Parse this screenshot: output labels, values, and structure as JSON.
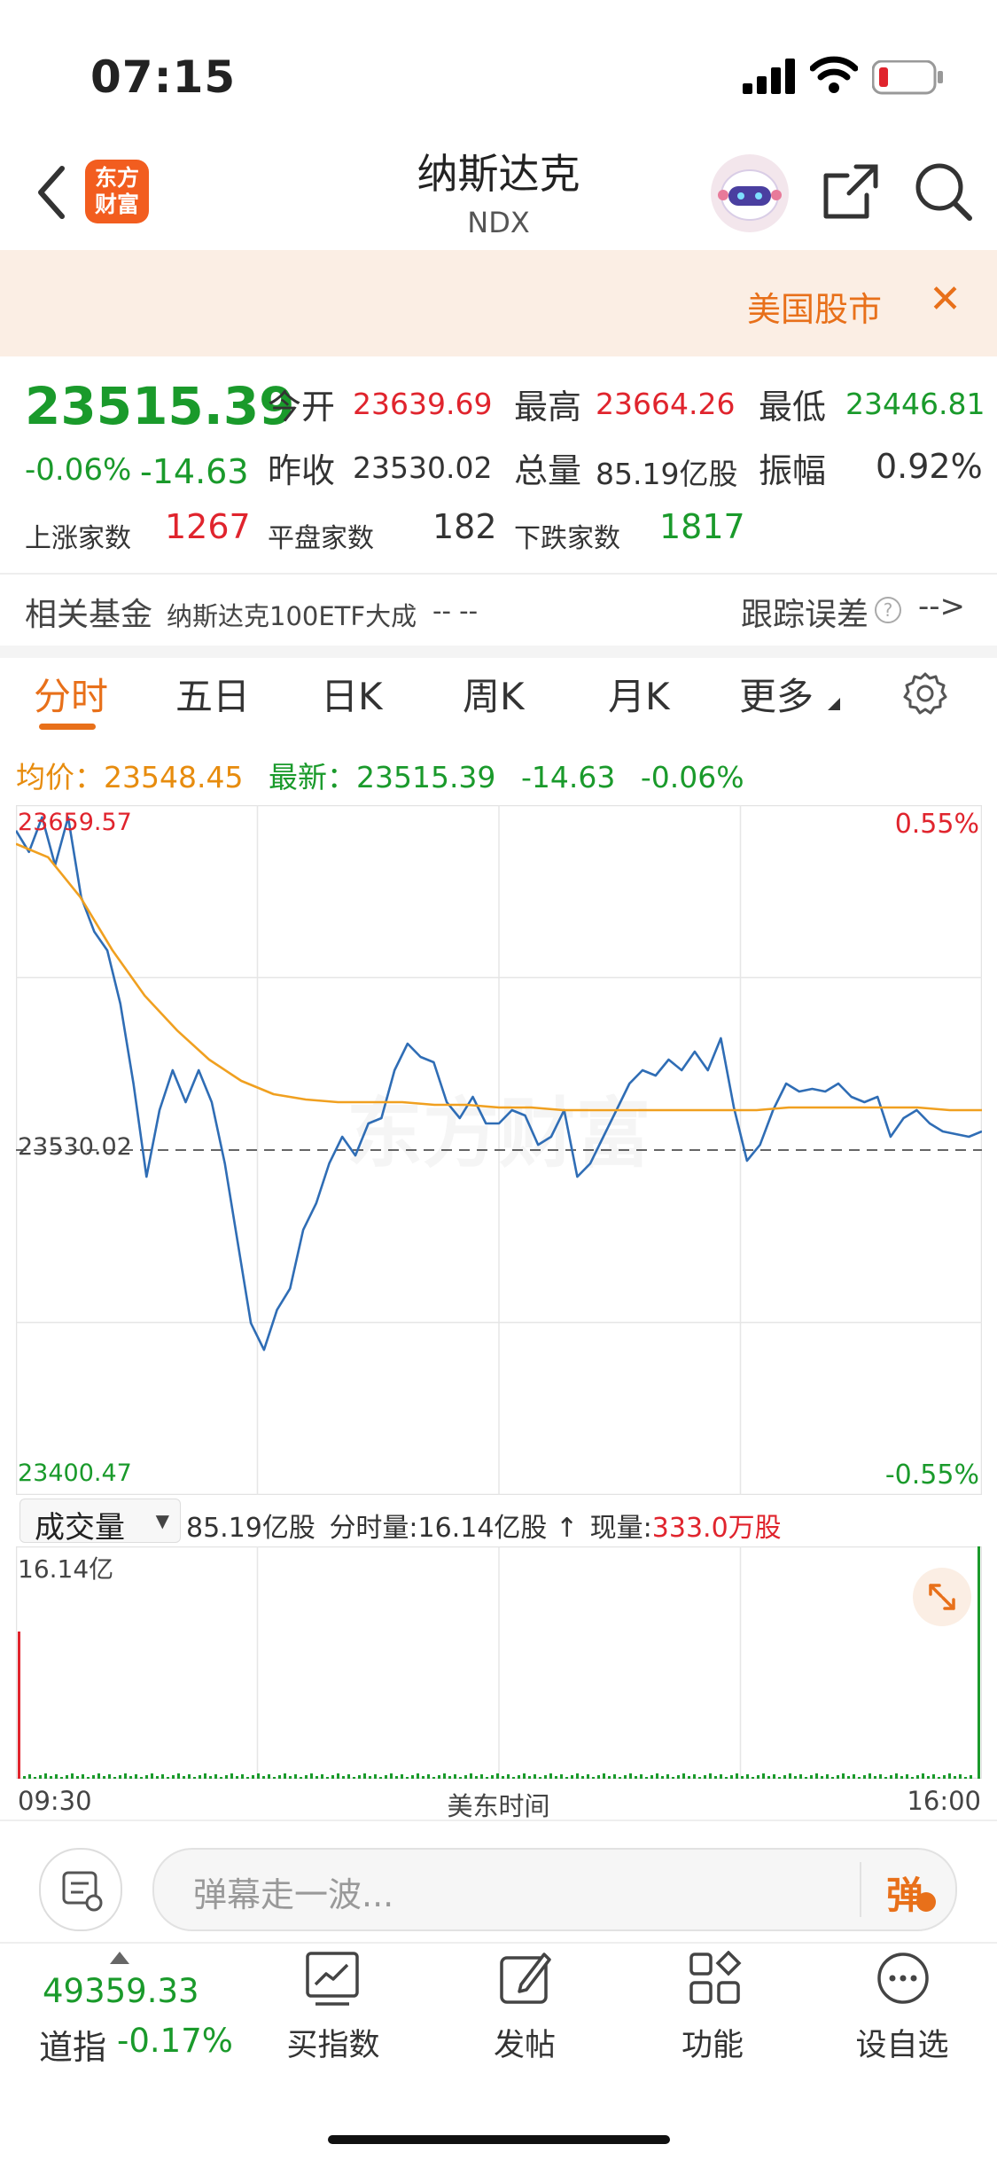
{
  "status_bar": {
    "time": "07:15"
  },
  "header": {
    "title": "纳斯达克",
    "code": "NDX",
    "logo_text": "东方\n财富"
  },
  "banner": {
    "text": "美国股市"
  },
  "quote": {
    "price": "23515.39",
    "change_pct": "-0.06%",
    "change": "-14.63",
    "open_label": "今开",
    "open": "23639.69",
    "high_label": "最高",
    "high": "23664.26",
    "low_label": "最低",
    "low": "23446.81",
    "prev_close_label": "昨收",
    "prev_close": "23530.02",
    "volume_label": "总量",
    "volume": "85.19亿股",
    "amplitude_label": "振幅",
    "amplitude": "0.92%",
    "up_count_label": "上涨家数",
    "up_count": "1267",
    "flat_count_label": "平盘家数",
    "flat_count": "182",
    "down_count_label": "下跌家数",
    "down_count": "1817"
  },
  "fund_row": {
    "label": "相关基金",
    "fund_name": "纳斯达克100ETF大成",
    "fund_value": "-- --",
    "tracking_label": "跟踪误差",
    "tracking_value": "-->"
  },
  "tabs": [
    "分时",
    "五日",
    "日K",
    "周K",
    "月K",
    "更多"
  ],
  "active_tab": 0,
  "legend": {
    "avg_label": "均价：",
    "avg": "23548.45",
    "latest_label": "最新：",
    "latest": "23515.39",
    "change": "-14.63",
    "change_pct": "-0.06%"
  },
  "chart_data": {
    "type": "line",
    "title": "",
    "watermark": "东方财富",
    "y_max_label": "23659.57",
    "y_min_label": "23400.47",
    "y_ref_label": "23530.02",
    "pct_max_label": "0.55%",
    "pct_min_label": "-0.55%",
    "ylim": [
      23400.47,
      23659.57
    ],
    "reference": 23530.02,
    "x_start": "09:30",
    "x_end": "16:00",
    "xlabel": "美东时间",
    "series": [
      {
        "name": "最新",
        "color": "#2f6db5",
        "values": [
          23650,
          23642,
          23655,
          23637,
          23655,
          23625,
          23612,
          23605,
          23585,
          23555,
          23520,
          23545,
          23560,
          23548,
          23560,
          23548,
          23525,
          23495,
          23465,
          23455,
          23470,
          23478,
          23500,
          23510,
          23525,
          23535,
          23528,
          23540,
          23542,
          23560,
          23570,
          23565,
          23563,
          23548,
          23542,
          23550,
          23540,
          23540,
          23545,
          23543,
          23532,
          23535,
          23545,
          23520,
          23525,
          23535,
          23545,
          23555,
          23560,
          23558,
          23564,
          23560,
          23567,
          23560,
          23572,
          23546,
          23526,
          23532,
          23545,
          23555,
          23552,
          23553,
          23552,
          23555,
          23550,
          23548,
          23550,
          23535,
          23542,
          23545,
          23540,
          23537,
          23536,
          23535,
          23537
        ]
      },
      {
        "name": "均价",
        "color": "#f0a020",
        "values": [
          23645,
          23640,
          23625,
          23605,
          23588,
          23575,
          23564,
          23556,
          23551,
          23549,
          23548,
          23548,
          23548,
          23547,
          23547,
          23546,
          23546,
          23545,
          23545,
          23545,
          23545,
          23545,
          23545,
          23545,
          23546,
          23546,
          23546,
          23546,
          23546,
          23545,
          23545
        ]
      }
    ]
  },
  "volume": {
    "selector": "成交量",
    "total": "85.19亿股",
    "interval_label": "分时量:",
    "interval": "16.14亿股",
    "arrow": "↑",
    "current_label": "现量:",
    "current": "333.0万股",
    "max_label": "16.14亿"
  },
  "comment_bar": {
    "placeholder": "弹幕走一波...",
    "danmu_label": "弹"
  },
  "bottom_nav": {
    "index_value": "49359.33",
    "index_name": "道指",
    "index_change": "-0.17%",
    "items": [
      "买指数",
      "发帖",
      "功能",
      "设自选"
    ]
  },
  "colors": {
    "up": "#e0242d",
    "down": "#1a9a2b",
    "accent": "#e8701a"
  }
}
